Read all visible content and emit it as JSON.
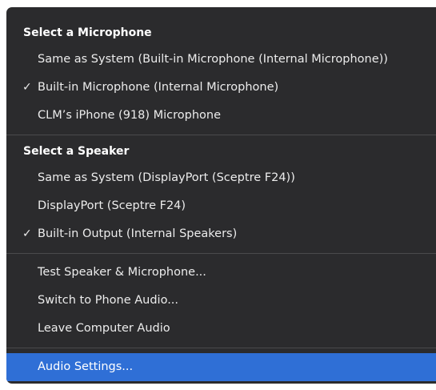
{
  "microphone_section": {
    "header": "Select a Microphone",
    "items": [
      {
        "label": "Same as System (Built-in Microphone (Internal Microphone))",
        "checked": false
      },
      {
        "label": "Built-in Microphone (Internal Microphone)",
        "checked": true
      },
      {
        "label": "CLM’s iPhone (918) Microphone",
        "checked": false
      }
    ]
  },
  "speaker_section": {
    "header": "Select a Speaker",
    "items": [
      {
        "label": "Same as System (DisplayPort (Sceptre F24))",
        "checked": false
      },
      {
        "label": "DisplayPort (Sceptre F24)",
        "checked": false
      },
      {
        "label": "Built-in Output (Internal Speakers)",
        "checked": true
      }
    ]
  },
  "actions": [
    {
      "label": "Test Speaker & Microphone..."
    },
    {
      "label": "Switch to Phone Audio..."
    },
    {
      "label": "Leave Computer Audio"
    }
  ],
  "settings": {
    "label": "Audio Settings...",
    "highlighted": true
  },
  "check_glyph": "✓",
  "colors": {
    "menu_bg": "#2b2b2d",
    "highlight": "#2f6fd6",
    "separator": "#4a4a4c"
  }
}
